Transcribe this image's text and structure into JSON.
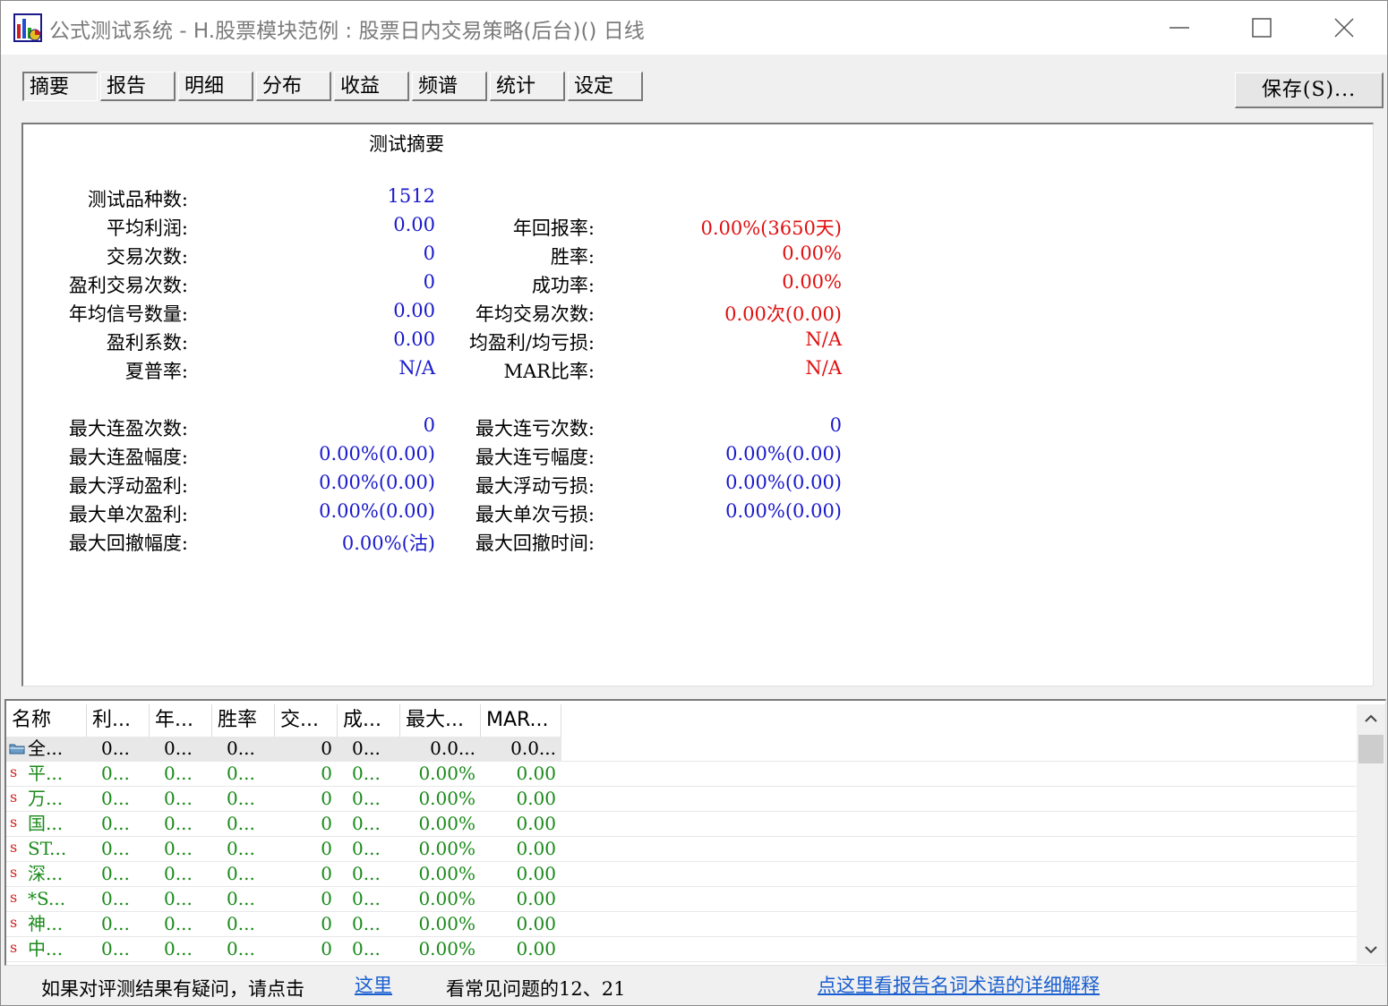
{
  "window": {
    "title": "公式测试系统 - H.股票模块范例 : 股票日内交易策略(后台)() 日线"
  },
  "tabs": [
    {
      "label": "摘要",
      "active": true
    },
    {
      "label": "报告"
    },
    {
      "label": "明细"
    },
    {
      "label": "分布"
    },
    {
      "label": "收益"
    },
    {
      "label": "频谱"
    },
    {
      "label": "统计"
    },
    {
      "label": "设定"
    }
  ],
  "save_label": "保存(S)...",
  "summary": {
    "heading": "测试摘要",
    "left": [
      {
        "label": "测试品种数:",
        "value": "1512"
      },
      {
        "label": "平均利润:",
        "value": "0.00"
      },
      {
        "label": "交易次数:",
        "value": "0"
      },
      {
        "label": "盈利交易次数:",
        "value": "0"
      },
      {
        "label": "年均信号数量:",
        "value": "0.00"
      },
      {
        "label": "盈利系数:",
        "value": "0.00"
      },
      {
        "label": "夏普率:",
        "value": "N/A"
      },
      {
        "label": "最大连盈次数:",
        "value": "0"
      },
      {
        "label": "最大连盈幅度:",
        "value": "0.00%(0.00)"
      },
      {
        "label": "最大浮动盈利:",
        "value": "0.00%(0.00)"
      },
      {
        "label": "最大单次盈利:",
        "value": "0.00%(0.00)"
      },
      {
        "label": "最大回撤幅度:",
        "value": "0.00%(沽)"
      }
    ],
    "right": [
      {
        "label": "年回报率:",
        "value": "0.00%(3650天)"
      },
      {
        "label": "胜率:",
        "value": "0.00%"
      },
      {
        "label": "成功率:",
        "value": "0.00%"
      },
      {
        "label": "年均交易次数:",
        "value": "0.00次(0.00)"
      },
      {
        "label": "均盈利/均亏损:",
        "value": "N/A"
      },
      {
        "label": "MAR比率:",
        "value": "N/A"
      },
      {
        "label": "最大连亏次数:",
        "value": "0"
      },
      {
        "label": "最大连亏幅度:",
        "value": "0.00%(0.00)"
      },
      {
        "label": "最大浮动亏损:",
        "value": "0.00%(0.00)"
      },
      {
        "label": "最大单次亏损:",
        "value": "0.00%(0.00)"
      },
      {
        "label": "最大回撤时间:",
        "value": ""
      }
    ],
    "colors": {
      "blue": "#1a1acc",
      "red": "#e01010"
    }
  },
  "table": {
    "columns": [
      "名称",
      "利...",
      "年...",
      "胜率",
      "交...",
      "成...",
      "最大...",
      "MAR..."
    ],
    "row_mark": "s",
    "rows": [
      {
        "name": "全...",
        "c1": "0...",
        "c2": "0...",
        "c3": "0...",
        "c4": "0",
        "c5": "0...",
        "c6": "0.0...",
        "c7": "0.0..."
      },
      {
        "name": "平...",
        "c1": "0...",
        "c2": "0...",
        "c3": "0...",
        "c4": "0",
        "c5": "0...",
        "c6": "0.00%",
        "c7": "0.00"
      },
      {
        "name": "万...",
        "c1": "0...",
        "c2": "0...",
        "c3": "0...",
        "c4": "0",
        "c5": "0...",
        "c6": "0.00%",
        "c7": "0.00"
      },
      {
        "name": "国...",
        "c1": "0...",
        "c2": "0...",
        "c3": "0...",
        "c4": "0",
        "c5": "0...",
        "c6": "0.00%",
        "c7": "0.00"
      },
      {
        "name": "ST...",
        "c1": "0...",
        "c2": "0...",
        "c3": "0...",
        "c4": "0",
        "c5": "0...",
        "c6": "0.00%",
        "c7": "0.00"
      },
      {
        "name": "深...",
        "c1": "0...",
        "c2": "0...",
        "c3": "0...",
        "c4": "0",
        "c5": "0...",
        "c6": "0.00%",
        "c7": "0.00"
      },
      {
        "name": "*S...",
        "c1": "0...",
        "c2": "0...",
        "c3": "0...",
        "c4": "0",
        "c5": "0...",
        "c6": "0.00%",
        "c7": "0.00"
      },
      {
        "name": "神...",
        "c1": "0...",
        "c2": "0...",
        "c3": "0...",
        "c4": "0",
        "c5": "0...",
        "c6": "0.00%",
        "c7": "0.00"
      },
      {
        "name": "中...",
        "c1": "0...",
        "c2": "0...",
        "c3": "0...",
        "c4": "0",
        "c5": "0...",
        "c6": "0.00%",
        "c7": "0.00"
      }
    ]
  },
  "footer": {
    "text1": "如果对评测结果有疑问，请点击",
    "link1": "这里",
    "text2": "看常见问题的12、21",
    "link2": "点这里看报告名词术语的详细解释"
  }
}
